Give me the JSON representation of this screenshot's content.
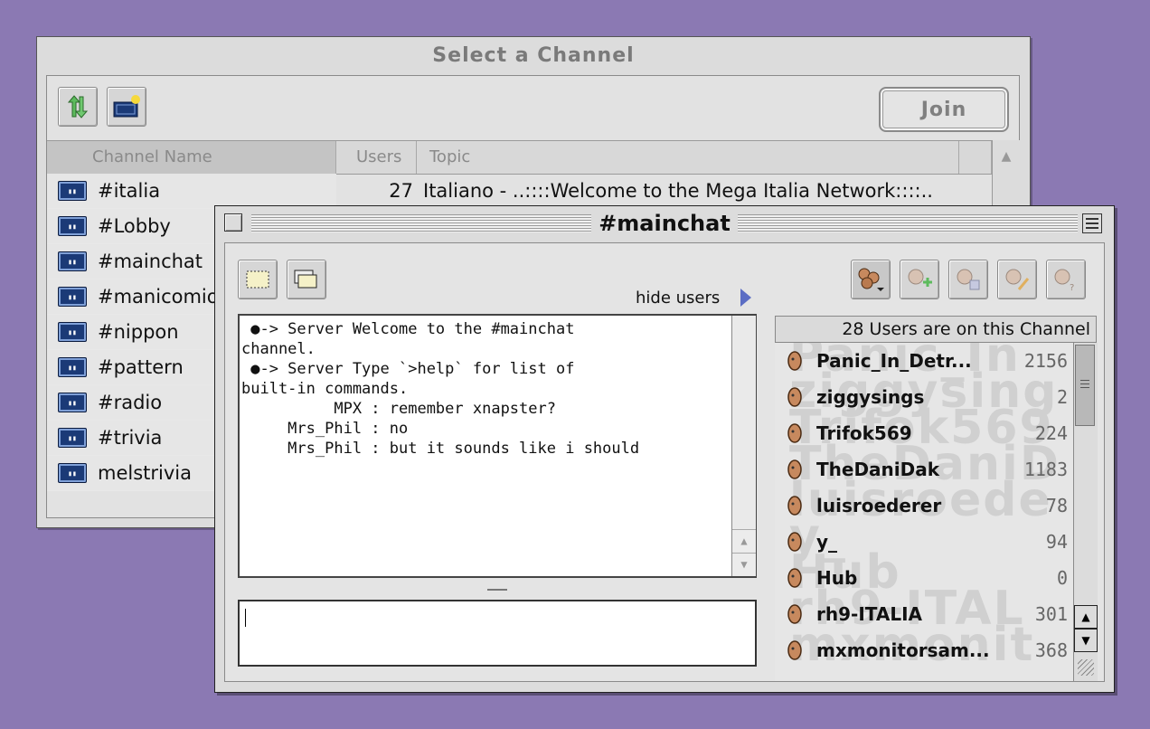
{
  "channel_window": {
    "title": "Select a Channel",
    "join_label": "Join",
    "columns": {
      "name": "Channel Name",
      "users": "Users",
      "topic": "Topic"
    },
    "channels": [
      {
        "name": "#italia",
        "users": "27",
        "topic": "Italiano - ..::::Welcome to the Mega Italia Network::::.."
      },
      {
        "name": "#Lobby",
        "users": "",
        "topic": ""
      },
      {
        "name": "#mainchat",
        "users": "",
        "topic": ""
      },
      {
        "name": "#manicomio",
        "users": "",
        "topic": ""
      },
      {
        "name": "#nippon",
        "users": "",
        "topic": ""
      },
      {
        "name": "#pattern",
        "users": "",
        "topic": ""
      },
      {
        "name": "#radio",
        "users": "",
        "topic": ""
      },
      {
        "name": "#trivia",
        "users": "",
        "topic": ""
      },
      {
        "name": "melstrivia",
        "users": "",
        "topic": ""
      }
    ]
  },
  "chat_window": {
    "title": "#mainchat",
    "hide_users_label": "hide users",
    "log_lines": [
      " ●-> Server Welcome to the #mainchat",
      "channel.",
      " ●-> Server Type `>help` for list of",
      "built-in commands.",
      "          MPX : remember xnapster?",
      "     Mrs_Phil : no",
      "     Mrs_Phil : but it sounds like i should"
    ],
    "input_value": "",
    "users_header": "28 Users are on this Channel",
    "users": [
      {
        "name": "Panic_In_Detr...",
        "count": "2156"
      },
      {
        "name": "ziggysings",
        "count": "2"
      },
      {
        "name": "Trifok569",
        "count": "224"
      },
      {
        "name": "TheDaniDak",
        "count": "1183"
      },
      {
        "name": "luisroederer",
        "count": "78"
      },
      {
        "name": "y_",
        "count": "94"
      },
      {
        "name": "Hub",
        "count": "0"
      },
      {
        "name": "rh9-ITALIA",
        "count": "301"
      },
      {
        "name": "mxmonitorsam...",
        "count": "368"
      }
    ]
  },
  "colors": {
    "desktop": "#8b79b3",
    "channel_icon": "#1b3a77",
    "hide_users_arrow": "#5b6dc4"
  },
  "icons": {
    "refresh": "refresh-arrows-icon",
    "new_channel": "new-channel-icon",
    "user_actions": [
      "users-menu-icon",
      "add-user-icon",
      "user-info-icon",
      "user-edit-icon",
      "user-help-icon"
    ],
    "user": "user-head-icon"
  }
}
